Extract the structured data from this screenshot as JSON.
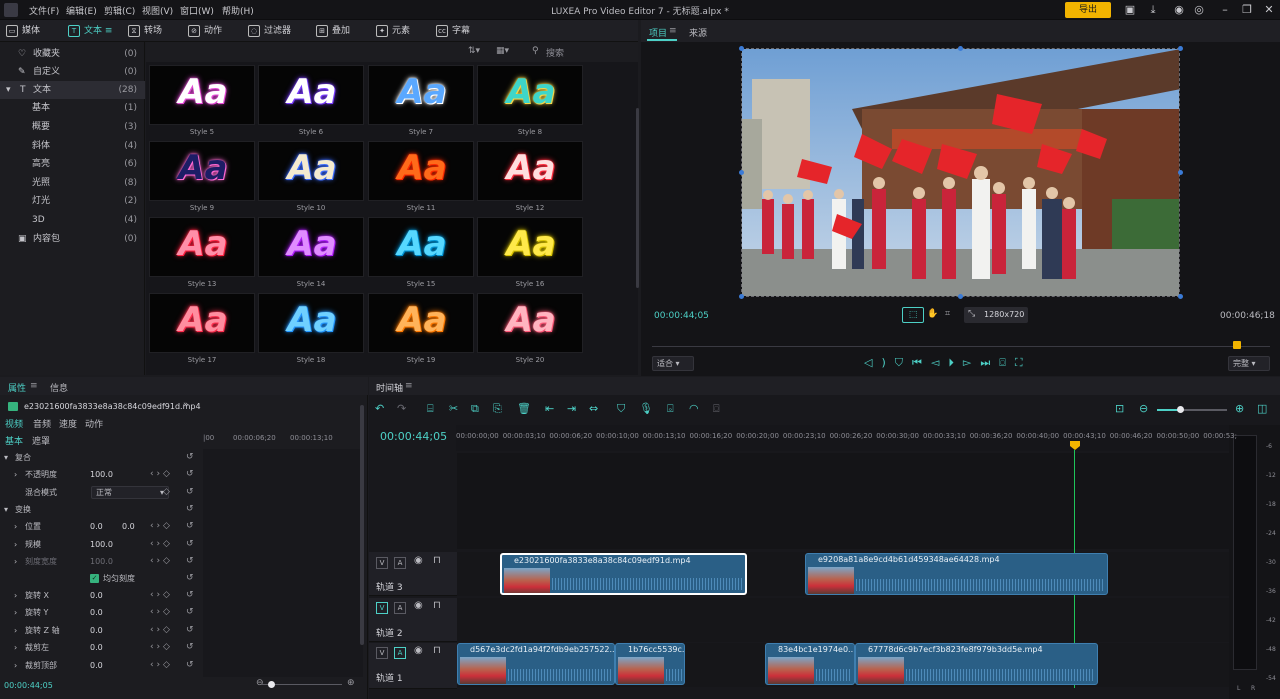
{
  "menu": [
    "文件(F)",
    "编辑(E)",
    "剪辑(C)",
    "视图(V)",
    "窗口(W)",
    "帮助(H)"
  ],
  "app_title": "LUXEA Pro Video Editor 7 - 无标题.alpx *",
  "export_label": "导出",
  "lib_tabs": [
    "媒体",
    "文本",
    "转场",
    "动作",
    "过滤器",
    "叠加",
    "元素",
    "字幕"
  ],
  "lib_search_placeholder": "搜索",
  "categories": [
    {
      "label": "收藏夹",
      "count": "(0)"
    },
    {
      "label": "自定义",
      "count": "(0)"
    },
    {
      "label": "文本",
      "count": "(28)"
    },
    {
      "label": "基本",
      "count": "(1)"
    },
    {
      "label": "概要",
      "count": "(3)"
    },
    {
      "label": "斜体",
      "count": "(4)"
    },
    {
      "label": "高亮",
      "count": "(6)"
    },
    {
      "label": "光照",
      "count": "(8)"
    },
    {
      "label": "灯光",
      "count": "(2)"
    },
    {
      "label": "3D",
      "count": "(4)"
    },
    {
      "label": "内容包",
      "count": "(0)"
    }
  ],
  "tiles": [
    {
      "text": "Aa",
      "label": "Style 5",
      "color": "#ffffff",
      "glow": "#e64bd8"
    },
    {
      "text": "Aa",
      "label": "Style 6",
      "color": "#ffffff",
      "glow": "#7a3cff"
    },
    {
      "text": "Aa",
      "label": "Style 7",
      "color": "#5aa8ff",
      "glow": "#ffffff"
    },
    {
      "text": "Aa",
      "label": "Style 8",
      "color": "#3ed6c9",
      "glow": "#f4d64a"
    },
    {
      "text": "Aa",
      "label": "Style 9",
      "color": "#1d1d66",
      "glow": "#ff6ad5"
    },
    {
      "text": "Aa",
      "label": "Style 10",
      "color": "#f4ead0",
      "glow": "#3d6cff"
    },
    {
      "text": "Aa",
      "label": "Style 11",
      "color": "#ff6a1a",
      "glow": "#ff2a00"
    },
    {
      "text": "Aa",
      "label": "Style 12",
      "color": "#ffdede",
      "glow": "#ff2b3d"
    },
    {
      "text": "Aa",
      "label": "Style 13",
      "color": "#ff8fa8",
      "glow": "#ff2140"
    },
    {
      "text": "Aa",
      "label": "Style 14",
      "color": "#e08cff",
      "glow": "#b21dff"
    },
    {
      "text": "Aa",
      "label": "Style 15",
      "color": "#56d8ff",
      "glow": "#0094d6"
    },
    {
      "text": "Aa",
      "label": "Style 16",
      "color": "#ffe94a",
      "glow": "#d9c300"
    },
    {
      "text": "Aa",
      "label": "Style 17",
      "color": "#ff8ea0",
      "glow": "#ff2f4f"
    },
    {
      "text": "Aa",
      "label": "Style 18",
      "color": "#6fd0ff",
      "glow": "#2496ff"
    },
    {
      "text": "Aa",
      "label": "Style 19",
      "color": "#ffb35a",
      "glow": "#ff7a00"
    },
    {
      "text": "Aa",
      "label": "Style 20",
      "color": "#ffb4c0",
      "glow": "#ff5a7a"
    }
  ],
  "preview": {
    "tabs": [
      "项目",
      "来源"
    ],
    "current_time": "00:00:44;05",
    "total_time": "00:00:46;18",
    "resolution": "1280x720",
    "fit_label": "适合",
    "quality_label": "完整"
  },
  "props": {
    "tabs": [
      "属性",
      "信息"
    ],
    "filename": "e23021600fa3833e8a38c84c09edf91d.mp4",
    "subtabs": [
      "视频",
      "音频",
      "速度",
      "动作"
    ],
    "mode_tabs": [
      "基本",
      "遮罩"
    ],
    "ruler": [
      "00:00:06;20",
      "00:00:13;10"
    ],
    "sections": {
      "composite": "复合",
      "transform": "变换"
    },
    "rows": [
      {
        "label": "不透明度",
        "value": "100.0"
      },
      {
        "label": "混合模式",
        "value": "正常"
      },
      {
        "label": "位置",
        "value": "0.0",
        "value2": "0.0"
      },
      {
        "label": "规模",
        "value": "100.0"
      },
      {
        "label": "刻度宽度",
        "value": "100.0"
      },
      {
        "label": "旋转 X",
        "value": "0.0"
      },
      {
        "label": "旋转 Y",
        "value": "0.0"
      },
      {
        "label": "旋转 Z 轴",
        "value": "0.0"
      },
      {
        "label": "裁剪左",
        "value": "0.0"
      },
      {
        "label": "裁剪顶部",
        "value": "0.0"
      }
    ],
    "uniform_label": "均匀刻度",
    "bottom_time": "00:00:44;05"
  },
  "timeline": {
    "tab": "时间轴",
    "current_time": "00:00:44;05",
    "ruler": [
      "00:00:00;00",
      "00:00:03;10",
      "00:00:06;20",
      "00:00:10;00",
      "00:00:13;10",
      "00:00:16;20",
      "00:00:20;00",
      "00:00:23;10",
      "00:00:26;20",
      "00:00:30;00",
      "00:00:33;10",
      "00:00:36;20",
      "00:00:40;00",
      "00:00:43;10",
      "00:00:46;20",
      "00:00:50;00",
      "00:00:53;"
    ],
    "tracks": [
      {
        "name": "轨道 3"
      },
      {
        "name": "轨道 2"
      },
      {
        "name": "轨道 1"
      }
    ],
    "clips_track3": [
      "e23021600fa3833e8a38c84c09edf91d.mp4",
      "e9208a81a8e9cd4b61d459348ae64428.mp4"
    ],
    "clips_track1": [
      "d567e3dc2fd1a94f2fdb9eb257522...",
      "1b76cc5539c...",
      "83e4bc1e1974e0...",
      "67778d6c9b7ecf3b823fe8f979b3dd5e.mp4"
    ],
    "meter_labels": [
      "-6",
      "-12",
      "-18",
      "-24",
      "-30",
      "-36",
      "-42",
      "-48",
      "-54"
    ],
    "meter_lr": [
      "L",
      "R"
    ]
  },
  "colors": {
    "accent": "#4dd0c6",
    "export": "#f2b400",
    "clip": "#2a5f86",
    "playhead": "#f2b400"
  }
}
